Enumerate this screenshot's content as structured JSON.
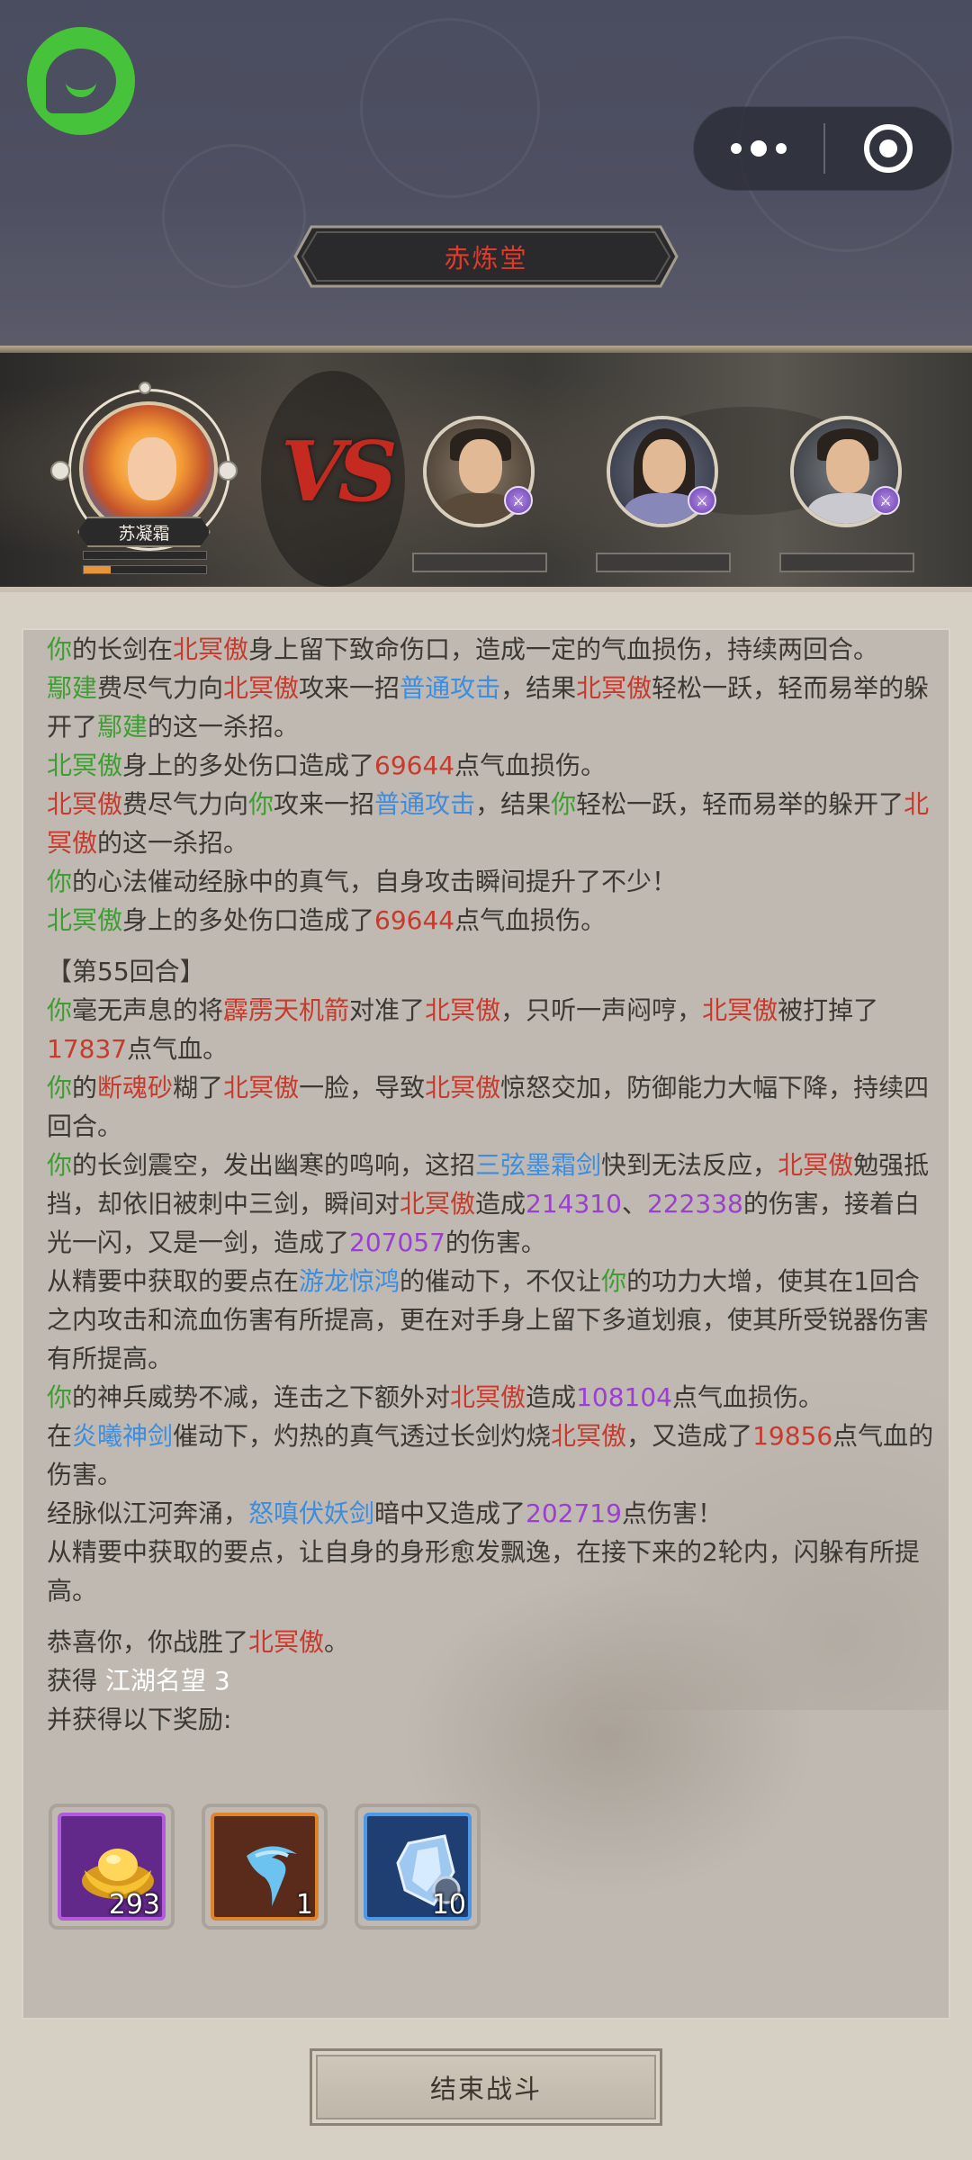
{
  "header": {
    "title": "赤炼堂"
  },
  "battle": {
    "hero": {
      "name": "苏凝霜",
      "hp_fraction": 0.0,
      "mp_fraction": 0.22
    },
    "vs_label": "VS",
    "enemies": [
      {
        "portrait": "bearded-warrior",
        "badge_icon": "sword-icon"
      },
      {
        "portrait": "long-hair-swordsman",
        "badge_icon": "sword-icon"
      },
      {
        "portrait": "young-swordsman",
        "badge_icon": "sword-icon"
      }
    ]
  },
  "log": {
    "l1": {
      "a": "你",
      "b": "的长剑在",
      "c": "北冥傲",
      "d": "身上留下致命伤口，造成一定的气血损伤，持续两回合。"
    },
    "l2": {
      "a": "鄢建",
      "b": "费尽气力向",
      "c": "北冥傲",
      "d": "攻来一招",
      "e": "普通攻击",
      "f": "，结果",
      "g": "北冥傲",
      "h": "轻松一跃，轻而易举的躲开了",
      "i": "鄢建",
      "j": "的这一杀招。"
    },
    "l3": {
      "a": "北冥傲",
      "b": "身上的多处伤口造成了",
      "c": "69644",
      "d": "点气血损伤。"
    },
    "l4": {
      "a": "北冥傲",
      "b": "费尽气力向",
      "c": "你",
      "d": "攻来一招",
      "e": "普通攻击",
      "f": "，结果",
      "g": "你",
      "h": "轻松一跃，轻而易举的躲开了",
      "i": "北冥傲",
      "j": "的这一杀招。"
    },
    "l5": {
      "a": "你",
      "b": "的心法催动经脉中的真气，自身攻击瞬间提升了不少！"
    },
    "l6": {
      "a": "北冥傲",
      "b": "身上的多处伤口造成了",
      "c": "69644",
      "d": "点气血损伤。"
    },
    "round": "【第55回合】",
    "l7": {
      "a": "你",
      "b": "毫无声息的将",
      "c": "霹雳天机箭",
      "d": "对准了",
      "e": "北冥傲",
      "f": "，只听一声闷哼，",
      "g": "北冥傲",
      "h": "被打掉了",
      "i": "17837",
      "j": "点气血。"
    },
    "l8": {
      "a": "你",
      "b": "的",
      "c": "断魂砂",
      "d": "糊了",
      "e": "北冥傲",
      "f": "一脸，导致",
      "g": "北冥傲",
      "h": "惊怒交加，防御能力大幅下降，持续四回合。"
    },
    "l9": {
      "a": "你",
      "b": "的长剑震空，发出幽寒的鸣响，这招",
      "c": "三弦墨霜剑",
      "d": "快到无法反应，",
      "e": "北冥傲",
      "f": "勉强抵挡，却依旧被刺中三剑，瞬间对",
      "g": "北冥傲",
      "h": "造成",
      "i": "214310",
      "j": "、",
      "k": "222338",
      "l": "的伤害，接着白光一闪，又是一剑，造成了",
      "m": "207057",
      "n": "的伤害。"
    },
    "l10": {
      "a": "从精要中获取的要点在",
      "b": "游龙惊鸿",
      "c": "的催动下，不仅让",
      "d": "你",
      "e": "的功力大增，使其在1回合之内攻击和流血伤害有所提高，更在对手身上留下多道划痕，使其所受锐器伤害有所提高。"
    },
    "l11": {
      "a": "你",
      "b": "的神兵威势不减，连击之下额外对",
      "c": "北冥傲",
      "d": "造成",
      "e": "108104",
      "f": "点气血损伤。"
    },
    "l12": {
      "a": "在",
      "b": "炎曦神剑",
      "c": "催动下，灼热的真气透过长剑灼烧",
      "d": "北冥傲",
      "e": "，又造成了",
      "f": "19856",
      "g": "点气血的伤害。"
    },
    "l13": {
      "a": "经脉似江河奔涌，",
      "b": "怒嗔伏妖剑",
      "c": "暗中又造成了",
      "d": "202719",
      "e": "点伤害！"
    },
    "l14": "从精要中获取的要点，让自身的身形愈发飘逸，在接下来的2轮内，闪躲有所提高。",
    "victory": {
      "a": "恭喜你，你战胜了",
      "b": "北冥傲",
      "c": "。"
    },
    "gain_label": "获得",
    "gain_value": "江湖名望 3",
    "rewards_label": "并获得以下奖励:"
  },
  "rewards": [
    {
      "icon": "gold-ingot-icon",
      "qty": "293",
      "rarity": "purple"
    },
    {
      "icon": "blue-swirl-icon",
      "qty": "1",
      "rarity": "orange"
    },
    {
      "icon": "crystal-shard-icon",
      "qty": "10",
      "rarity": "blue"
    }
  ],
  "end_button": "结束战斗",
  "colors": {
    "self": "#3d9e31",
    "enemy": "#c73a2d",
    "skill": "#3c8de0",
    "crit": "#9a3fd0"
  }
}
